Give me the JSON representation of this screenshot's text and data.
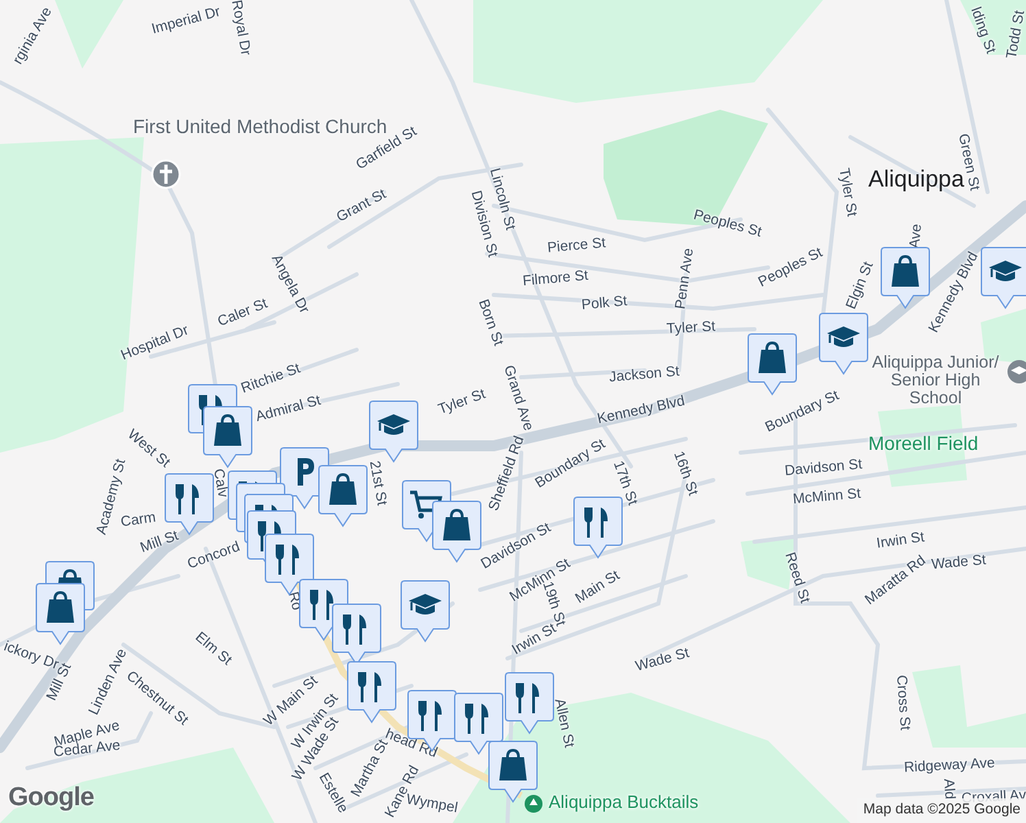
{
  "places": [
    {
      "kind": "church",
      "label": "First United Methodist Church"
    },
    {
      "kind": "city",
      "label": "Aliquippa"
    },
    {
      "kind": "school",
      "label": "Aliquippa Junior/ Senior High School"
    },
    {
      "kind": "park",
      "label": "Moreell Field"
    },
    {
      "kind": "park-pin",
      "label": "Aliquippa Bucktails"
    }
  ],
  "streets": [
    {
      "label": "rginia Ave"
    },
    {
      "label": "Imperial Dr"
    },
    {
      "label": "Royal Dr"
    },
    {
      "label": "Garfield St"
    },
    {
      "label": "Grant St"
    },
    {
      "label": "Lincoln St"
    },
    {
      "label": "Division St"
    },
    {
      "label": "Pierce St"
    },
    {
      "label": "Filmore St"
    },
    {
      "label": "Polk St"
    },
    {
      "label": "Tyler St"
    },
    {
      "label": "Jackson St"
    },
    {
      "label": "Peoples St"
    },
    {
      "label": "Peoples St"
    },
    {
      "label": "Penn Ave"
    },
    {
      "label": "Tyler St"
    },
    {
      "label": "Green St"
    },
    {
      "label": "lding St"
    },
    {
      "label": "Todd St"
    },
    {
      "label": "Elgin St"
    },
    {
      "label": "Ave"
    },
    {
      "label": "Kennedy Blvd"
    },
    {
      "label": "Kennedy Blvd"
    },
    {
      "label": "Born St"
    },
    {
      "label": "Grand Ave"
    },
    {
      "label": "Tyler St"
    },
    {
      "label": "Caler St"
    },
    {
      "label": "Hospital Dr"
    },
    {
      "label": "Angela Dr"
    },
    {
      "label": "Ritchie St"
    },
    {
      "label": "Admiral St"
    },
    {
      "label": "West St"
    },
    {
      "label": "Academy St"
    },
    {
      "label": "Carm"
    },
    {
      "label": "Mill St"
    },
    {
      "label": "Calv"
    },
    {
      "label": "Concord"
    },
    {
      "label": "21st St"
    },
    {
      "label": "Sheffield Rd"
    },
    {
      "label": "Boundary St"
    },
    {
      "label": "17th St"
    },
    {
      "label": "16th St"
    },
    {
      "label": "Davidson St"
    },
    {
      "label": "McMinn St"
    },
    {
      "label": "Main St"
    },
    {
      "label": "19th St"
    },
    {
      "label": "Irwin St"
    },
    {
      "label": "Wade St"
    },
    {
      "label": "Allen St"
    },
    {
      "label": "Boundary St"
    },
    {
      "label": "Davidson St"
    },
    {
      "label": "McMinn St"
    },
    {
      "label": "Irwin St"
    },
    {
      "label": "Wade St"
    },
    {
      "label": "Reed St"
    },
    {
      "label": "Maratta Rd"
    },
    {
      "label": "Cross St"
    },
    {
      "label": "Ridgeway Ave"
    },
    {
      "label": "Croxall Av"
    },
    {
      "label": "Ald"
    },
    {
      "label": "Elm St"
    },
    {
      "label": "Linden Ave"
    },
    {
      "label": "Chestnut St"
    },
    {
      "label": "Mill St"
    },
    {
      "label": "ickory Dr"
    },
    {
      "label": "Maple Ave"
    },
    {
      "label": "Cedar Ave"
    },
    {
      "label": "W Main St"
    },
    {
      "label": "W Irwin St"
    },
    {
      "label": "W Wade St"
    },
    {
      "label": "Martha St"
    },
    {
      "label": "Kane Rd"
    },
    {
      "label": "Estelle"
    },
    {
      "label": "Wympel"
    },
    {
      "label": "head Rd"
    },
    {
      "label": "Ro"
    }
  ],
  "pins": [
    {
      "kind": "dining"
    },
    {
      "kind": "shopping"
    },
    {
      "kind": "school"
    },
    {
      "kind": "dining"
    },
    {
      "kind": "parking"
    },
    {
      "kind": "shopping"
    },
    {
      "kind": "dining"
    },
    {
      "kind": "dining"
    },
    {
      "kind": "dining"
    },
    {
      "kind": "dining"
    },
    {
      "kind": "dining"
    },
    {
      "kind": "dining"
    },
    {
      "kind": "dining"
    },
    {
      "kind": "dining"
    },
    {
      "kind": "dining"
    },
    {
      "kind": "dining"
    },
    {
      "kind": "dining"
    },
    {
      "kind": "shopping"
    },
    {
      "kind": "grocery"
    },
    {
      "kind": "shopping"
    },
    {
      "kind": "school"
    },
    {
      "kind": "dining"
    },
    {
      "kind": "shopping"
    },
    {
      "kind": "shopping"
    },
    {
      "kind": "shopping"
    },
    {
      "kind": "school"
    },
    {
      "kind": "shopping"
    },
    {
      "kind": "school"
    }
  ],
  "footer": {
    "logo": "Google",
    "attribution": "Map data ©2025 Google"
  }
}
